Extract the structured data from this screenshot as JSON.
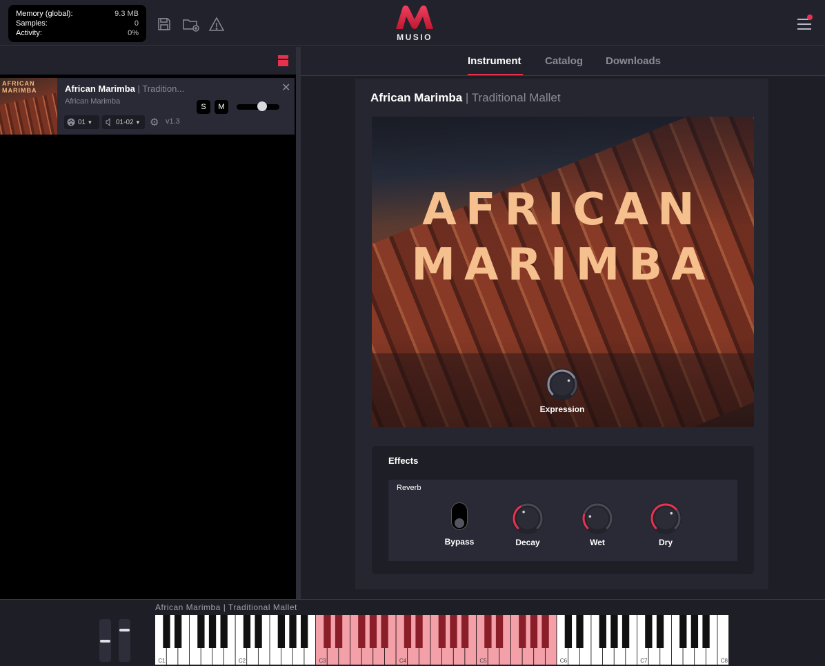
{
  "stats": {
    "memory_label": "Memory (global):",
    "memory_value": "9.3 MB",
    "samples_label": "Samples:",
    "samples_value": "0",
    "activity_label": "Activity:",
    "activity_value": "0%"
  },
  "logo": {
    "text": "MUSIO"
  },
  "tabs": [
    {
      "label": "Instrument",
      "active": true
    },
    {
      "label": "Catalog",
      "active": false
    },
    {
      "label": "Downloads",
      "active": false
    }
  ],
  "slot": {
    "thumb_text_1": "AFRICAN",
    "thumb_text_2": "MARIMBA",
    "title": "African Marimba",
    "subtitle_sep": " | ",
    "subtitle": "Tradition...",
    "library": "African Marimba",
    "solo_label": "S",
    "mute_label": "M",
    "volume": 0.62,
    "midi_channel": "01",
    "audio_out": "01-02",
    "version": "v1.3"
  },
  "instrument": {
    "name": "African Marimba",
    "sep": " | ",
    "articulation": "Traditional Mallet",
    "hero_line_1": "AFRICAN",
    "hero_line_2": "MARIMBA",
    "expression_label": "Expression",
    "expression_value": 0.72
  },
  "effects": {
    "title": "Effects",
    "reverb": {
      "title": "Reverb",
      "bypass_label": "Bypass",
      "bypass_on": false,
      "knobs": [
        {
          "label": "Decay",
          "value": 0.38
        },
        {
          "label": "Wet",
          "value": 0.22
        },
        {
          "label": "Dry",
          "value": 0.68
        }
      ]
    }
  },
  "keyboard": {
    "label": "African Marimba | Traditional Mallet",
    "octave_labels": [
      "C1",
      "C2",
      "C3",
      "C4",
      "C5",
      "C6",
      "C7",
      "C8"
    ],
    "range_highlight": [
      "C3",
      "C6"
    ],
    "pitch_wheel": 0.5,
    "mod_wheel": 0.8
  },
  "colors": {
    "accent": "#e8314f",
    "highlight_white": "#f4a0a8",
    "highlight_black": "#8a1e28"
  }
}
